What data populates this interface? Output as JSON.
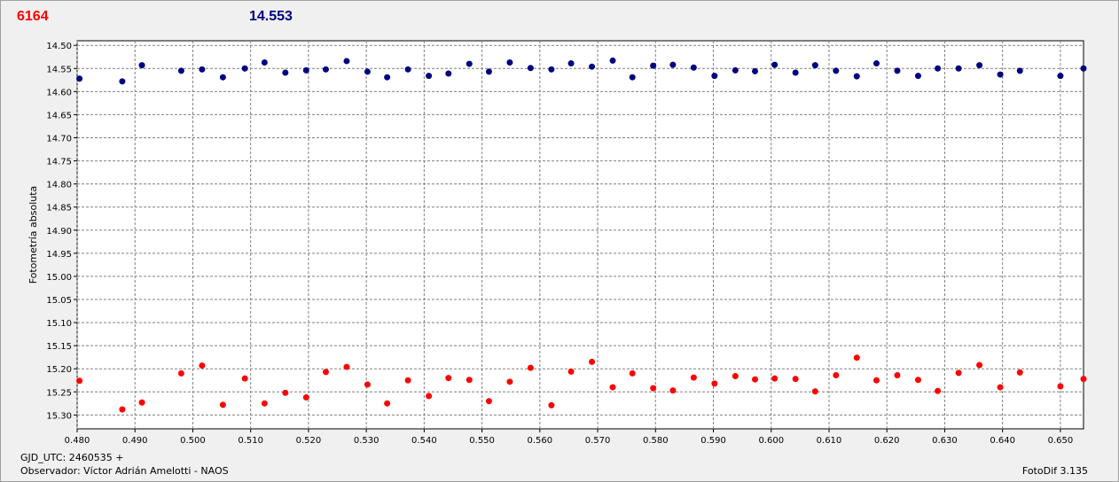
{
  "header": {
    "star_label": "6164",
    "comp_label": "14.553"
  },
  "footer": {
    "gjd": "GJD_UTC: 2460535 +",
    "observer": "Observador: Víctor Adrián Amelotti - NAOS",
    "app": "FotoDif 3.135"
  },
  "colors": {
    "star": "#ff0000",
    "comparison": "#000080",
    "grid": "#808080",
    "background": "#f0f0f0"
  },
  "chart_data": {
    "type": "scatter",
    "ylabel": "Fotometría absoluta",
    "xlabel": "",
    "xlim": [
      0.48,
      0.654
    ],
    "ylim": [
      15.33,
      14.49
    ],
    "y_inverted": true,
    "grid": true,
    "x_ticks": [
      "0.480",
      "0.490",
      "0.500",
      "0.510",
      "0.520",
      "0.530",
      "0.540",
      "0.550",
      "0.560",
      "0.570",
      "0.580",
      "0.590",
      "0.600",
      "0.610",
      "0.620",
      "0.630",
      "0.640",
      "0.650"
    ],
    "y_ticks": [
      "14.50",
      "14.55",
      "14.60",
      "14.65",
      "14.70",
      "14.75",
      "14.80",
      "14.85",
      "14.90",
      "14.95",
      "15.00",
      "15.05",
      "15.10",
      "15.15",
      "15.20",
      "15.25",
      "15.30"
    ],
    "series": [
      {
        "color": "#000080",
        "x": [
          0.4804,
          0.4878,
          0.4912,
          0.498,
          0.5016,
          0.5052,
          0.509,
          0.5124,
          0.516,
          0.5196,
          0.523,
          0.5266,
          0.5302,
          0.5336,
          0.5372,
          0.5408,
          0.5442,
          0.5478,
          0.5512,
          0.5548,
          0.5584,
          0.562,
          0.5654,
          0.569,
          0.5726,
          0.576,
          0.5796,
          0.583,
          0.5866,
          0.5902,
          0.5938,
          0.5972,
          0.6006,
          0.6042,
          0.6076,
          0.6112,
          0.6148,
          0.6182,
          0.6218,
          0.6254,
          0.6288,
          0.6324,
          0.636,
          0.6396,
          0.643,
          0.65,
          0.654
        ],
        "y": [
          14.572,
          14.578,
          14.543,
          14.555,
          14.552,
          14.569,
          14.55,
          14.537,
          14.559,
          14.554,
          14.552,
          14.534,
          14.557,
          14.569,
          14.552,
          14.566,
          14.561,
          14.54,
          14.557,
          14.537,
          14.549,
          14.552,
          14.539,
          14.546,
          14.533,
          14.569,
          14.544,
          14.542,
          14.548,
          14.566,
          14.554,
          14.556,
          14.542,
          14.559,
          14.543,
          14.555,
          14.567,
          14.539,
          14.555,
          14.566,
          14.55,
          14.55,
          14.543,
          14.563,
          14.555,
          14.566,
          14.55
        ]
      },
      {
        "color": "#ff0000",
        "x": [
          0.4804,
          0.4878,
          0.4912,
          0.498,
          0.5016,
          0.5052,
          0.509,
          0.5124,
          0.516,
          0.5196,
          0.523,
          0.5266,
          0.5302,
          0.5336,
          0.5372,
          0.5408,
          0.5442,
          0.5478,
          0.5512,
          0.5548,
          0.5584,
          0.562,
          0.5654,
          0.569,
          0.5726,
          0.576,
          0.5796,
          0.583,
          0.5866,
          0.5902,
          0.5938,
          0.5972,
          0.6006,
          0.6042,
          0.6076,
          0.6112,
          0.6148,
          0.6182,
          0.6218,
          0.6254,
          0.6288,
          0.6324,
          0.636,
          0.6396,
          0.643,
          0.65,
          0.654
        ],
        "y": [
          15.226,
          15.288,
          15.273,
          15.21,
          15.193,
          15.278,
          15.221,
          15.275,
          15.252,
          15.262,
          15.207,
          15.196,
          15.234,
          15.275,
          15.225,
          15.259,
          15.22,
          15.224,
          15.27,
          15.228,
          15.198,
          15.279,
          15.206,
          15.185,
          15.24,
          15.21,
          15.242,
          15.247,
          15.219,
          15.232,
          15.216,
          15.223,
          15.221,
          15.222,
          15.249,
          15.214,
          15.176,
          15.225,
          15.214,
          15.224,
          15.248,
          15.209,
          15.192,
          15.24,
          15.208,
          15.238,
          15.222
        ]
      }
    ]
  }
}
